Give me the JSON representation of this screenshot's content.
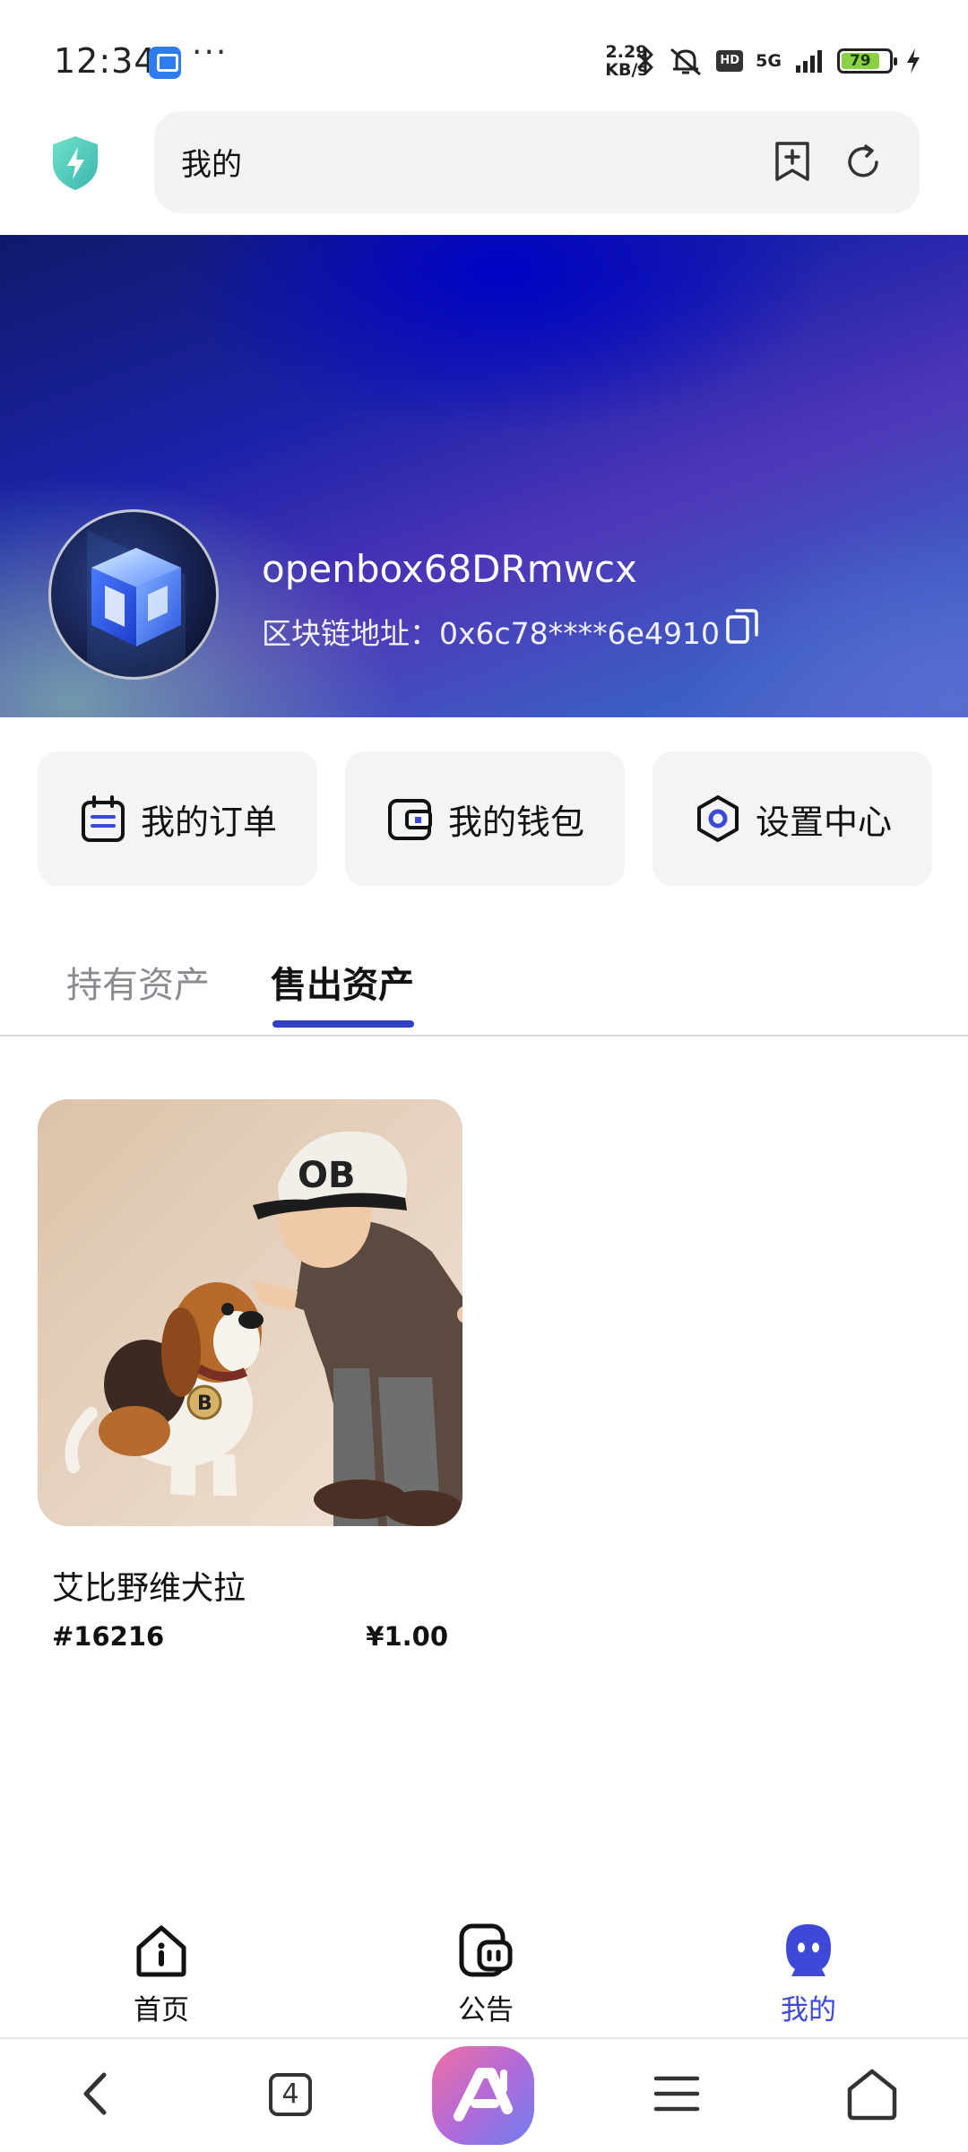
{
  "status_bar": {
    "time": "12:34",
    "more": "···",
    "net_speed_value": "2.29",
    "net_speed_unit": "KB/s",
    "hd": "HD",
    "network": "5G",
    "battery": "79"
  },
  "browser": {
    "url_text": "我的"
  },
  "profile": {
    "username": "openbox68DRmwcx",
    "address": "区块链地址：0x6c78****6e4910"
  },
  "actions": [
    {
      "label": "我的订单",
      "icon": "calendar-icon"
    },
    {
      "label": "我的钱包",
      "icon": "wallet-icon"
    },
    {
      "label": "设置中心",
      "icon": "settings-icon"
    }
  ],
  "tabs": [
    {
      "label": "持有资产",
      "active": false
    },
    {
      "label": "售出资产",
      "active": true
    }
  ],
  "assets": [
    {
      "name": "艾比野维犬拉",
      "id": "#16216",
      "price": "¥1.00"
    }
  ],
  "bottom_nav": [
    {
      "label": "首页",
      "icon": "home-icon",
      "active": false
    },
    {
      "label": "公告",
      "icon": "notice-icon",
      "active": false
    },
    {
      "label": "我的",
      "icon": "profile-icon",
      "active": true
    }
  ],
  "system_nav": {
    "tab_count": "4"
  },
  "colors": {
    "accent": "#3040c9",
    "active_nav": "#3e49d8",
    "card_bg": "#f4f4f6"
  }
}
